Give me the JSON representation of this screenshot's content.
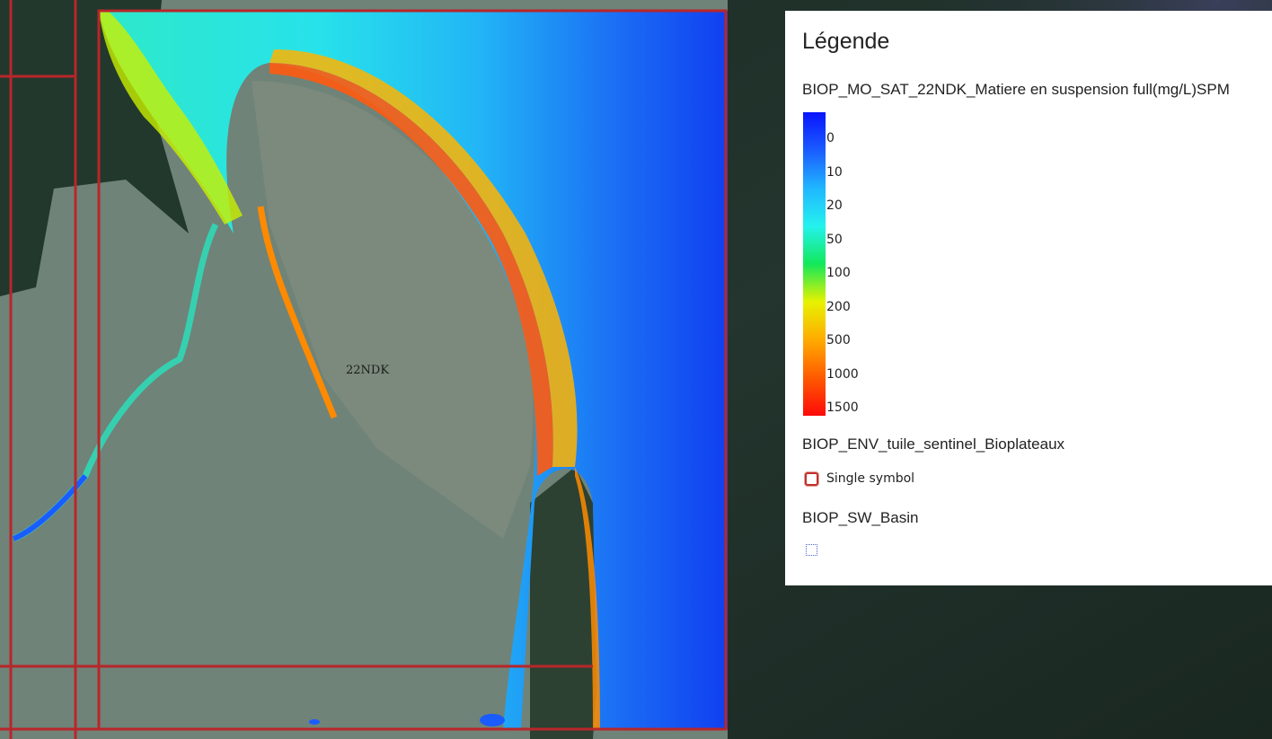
{
  "map": {
    "tile_label": "22NDK"
  },
  "legend": {
    "title": "Légende",
    "layers": [
      {
        "title": "BIOP_MO_SAT_22NDK_Matiere en suspension full(mg/L)SPM",
        "ramp_colors": [
          "#0a14ff",
          "#1a5cff",
          "#20b6ff",
          "#24f2ee",
          "#12e85a",
          "#e7f200",
          "#ffab00",
          "#ff5a00",
          "#ff0a0a"
        ],
        "ramp_labels": [
          "0",
          "10",
          "20",
          "50",
          "100",
          "200",
          "500",
          "1000",
          "1500"
        ]
      },
      {
        "title": "BIOP_ENV_tuile_sentinel_Bioplateaux",
        "symbol_label": "Single symbol",
        "symbol_color": "#c0302a"
      },
      {
        "title": "BIOP_SW_Basin",
        "symbol_color": "#4a63c9"
      }
    ]
  }
}
